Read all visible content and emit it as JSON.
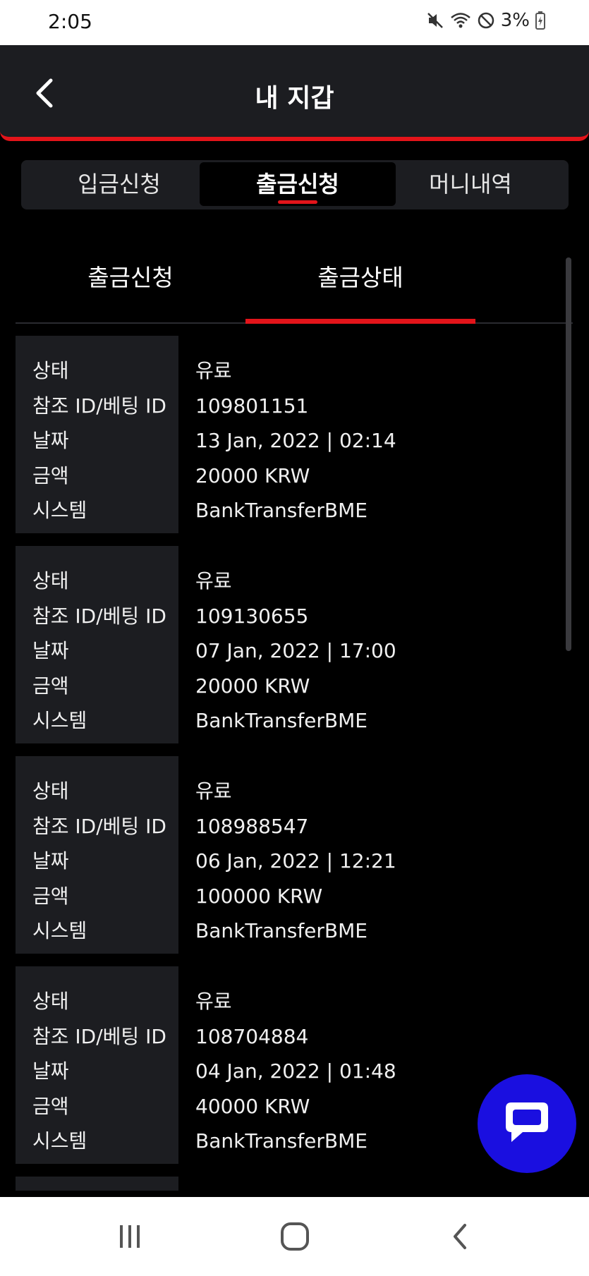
{
  "status_bar": {
    "time": "2:05",
    "battery_text": "3%",
    "icons": [
      "mute-icon",
      "wifi-icon",
      "do-not-disturb-icon",
      "battery-charging-icon"
    ]
  },
  "header": {
    "title": "내 지갑",
    "back_icon": "chevron-left-icon",
    "accent_color": "#e3141a"
  },
  "top_tabs": [
    {
      "label": "입금신청",
      "active": false
    },
    {
      "label": "출금신청",
      "active": true
    },
    {
      "label": "머니내역",
      "active": false
    }
  ],
  "sub_tabs": [
    {
      "label": "출금신청",
      "active": false
    },
    {
      "label": "출금상태",
      "active": true
    }
  ],
  "record_labels": {
    "status": "상태",
    "ref_id": "참조 ID/베팅 ID",
    "date": "날짜",
    "amount": "금액",
    "system": "시스템"
  },
  "records": [
    {
      "status": "유료",
      "ref_id": "109801151",
      "date": "13 Jan, 2022 | 02:14",
      "amount": "20000 KRW",
      "system": "BankTransferBME"
    },
    {
      "status": "유료",
      "ref_id": "109130655",
      "date": "07 Jan, 2022 | 17:00",
      "amount": "20000 KRW",
      "system": "BankTransferBME"
    },
    {
      "status": "유료",
      "ref_id": "108988547",
      "date": "06 Jan, 2022 | 12:21",
      "amount": "100000 KRW",
      "system": "BankTransferBME"
    },
    {
      "status": "유료",
      "ref_id": "108704884",
      "date": "04 Jan, 2022 | 01:48",
      "amount": "40000 KRW",
      "system": "BankTransferBME"
    }
  ],
  "chat_button": {
    "icon": "chat-bubble-icon",
    "color": "#1a0fe0"
  },
  "nav_bar": {
    "icons": [
      "recent-apps-icon",
      "home-icon",
      "back-icon"
    ]
  }
}
